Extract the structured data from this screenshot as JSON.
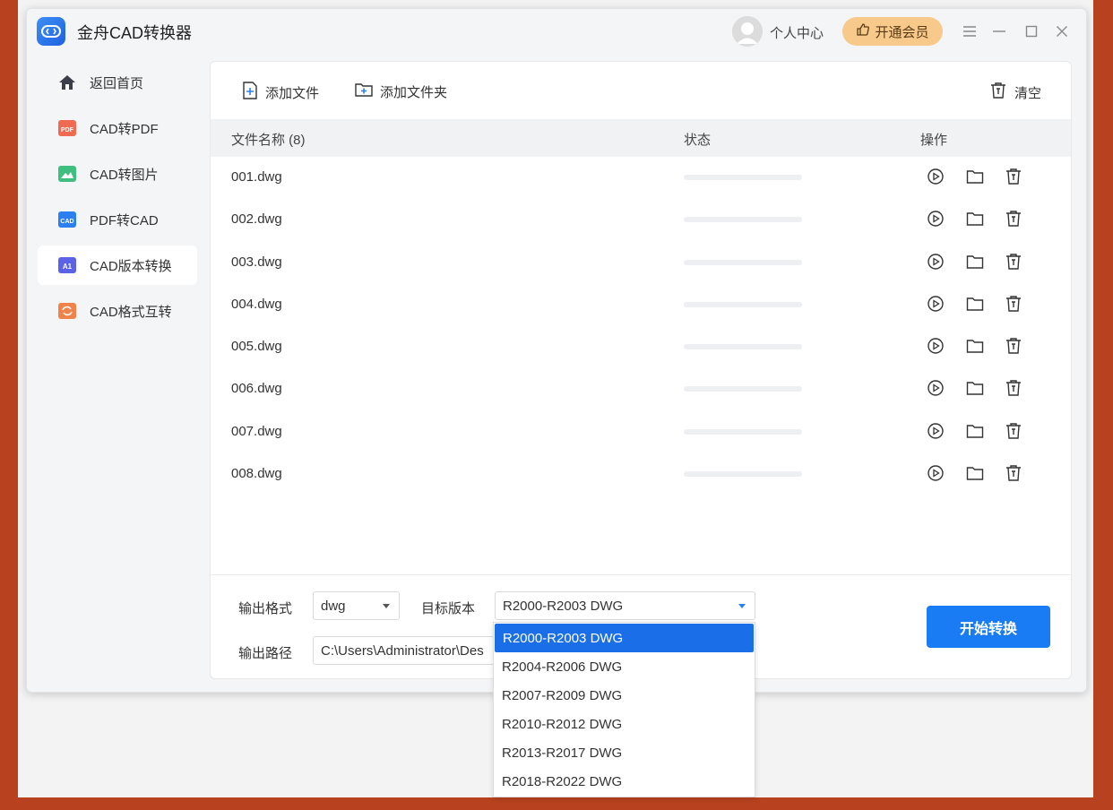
{
  "app": {
    "title": "金舟CAD转换器"
  },
  "titlebar": {
    "user_label": "个人中心",
    "vip_label": "开通会员"
  },
  "sidebar": {
    "items": [
      {
        "label": "返回首页",
        "icon": "home-icon"
      },
      {
        "label": "CAD转PDF",
        "icon": "pdf-icon",
        "badge": "PDF"
      },
      {
        "label": "CAD转图片",
        "icon": "image-icon"
      },
      {
        "label": "PDF转CAD",
        "icon": "cad-icon",
        "badge": "CAD"
      },
      {
        "label": "CAD版本转换",
        "icon": "version-icon",
        "badge": "A1"
      },
      {
        "label": "CAD格式互转",
        "icon": "format-icon"
      }
    ],
    "active_index": 4
  },
  "toolbar": {
    "add_file": "添加文件",
    "add_folder": "添加文件夹",
    "clear": "清空"
  },
  "table": {
    "col_name": "文件名称 (8)",
    "col_status": "状态",
    "col_ops": "操作",
    "rows": [
      {
        "name": "001.dwg",
        "progress": 0
      },
      {
        "name": "002.dwg",
        "progress": 0
      },
      {
        "name": "003.dwg",
        "progress": 0
      },
      {
        "name": "004.dwg",
        "progress": 0
      },
      {
        "name": "005.dwg",
        "progress": 0
      },
      {
        "name": "006.dwg",
        "progress": 0
      },
      {
        "name": "007.dwg",
        "progress": 0
      },
      {
        "name": "008.dwg",
        "progress": 0
      }
    ]
  },
  "bottom": {
    "format_label": "输出格式",
    "format_value": "dwg",
    "version_label": "目标版本",
    "version_value": "R2000-R2003 DWG",
    "path_label": "输出路径",
    "path_value": "C:\\Users\\Administrator\\Des",
    "start_label": "开始转换"
  },
  "dropdown": {
    "options": [
      "R2000-R2003 DWG",
      "R2004-R2006 DWG",
      "R2007-R2009 DWG",
      "R2010-R2012 DWG",
      "R2013-R2017 DWG",
      "R2018-R2022 DWG"
    ],
    "selected_index": 0
  },
  "colors": {
    "accent": "#1a7cf5",
    "vip": "#f7c98b",
    "background": "#b8421f"
  }
}
